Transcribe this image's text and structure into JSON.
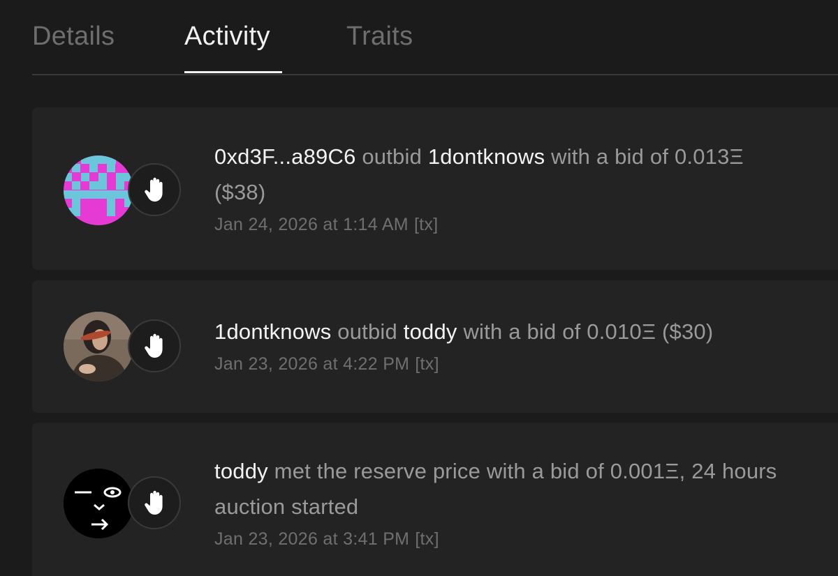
{
  "tabs": [
    {
      "label": "Details"
    },
    {
      "label": "Activity"
    },
    {
      "label": "Traits"
    }
  ],
  "activity": [
    {
      "actor": "0xd3F...a89C6",
      "action": "outbid",
      "target": "1dontknows",
      "detail": "with a bid of 0.013Ξ ($38)",
      "timestamp": "Jan 24, 2026 at 1:14 AM",
      "tx_label": "[tx]",
      "icon": "hand-icon"
    },
    {
      "actor": "1dontknows",
      "action": "outbid",
      "target": "toddy",
      "detail": "with a bid of 0.010Ξ ($30)",
      "timestamp": "Jan 23, 2026 at 4:22 PM",
      "tx_label": "[tx]",
      "icon": "hand-icon"
    },
    {
      "actor": "toddy",
      "action": "met the reserve price with a bid of 0.001Ξ, 24 hours auction started",
      "timestamp": "Jan 23, 2026 at 3:41 PM",
      "tx_label": "[tx]",
      "icon": "hand-icon"
    }
  ],
  "colors": {
    "background": "#1b1b1b",
    "card": "#232323",
    "text_primary": "#f3f3f3",
    "text_secondary": "#9a9a9a",
    "text_muted": "#6f6f6f",
    "pixel_avatar_pink": "#e53ad3",
    "pixel_avatar_cyan": "#6bc6dc"
  }
}
